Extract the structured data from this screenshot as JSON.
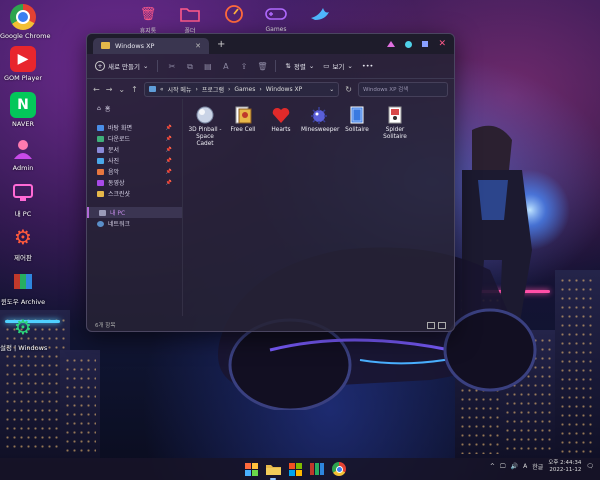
{
  "desktop": {
    "icons": [
      {
        "label": "Google Chrome",
        "icon": "chrome-icon"
      },
      {
        "label": "GOM Player",
        "icon": "gom-player-icon"
      },
      {
        "label": "NAVER",
        "icon": "naver-icon"
      },
      {
        "label": "Admin",
        "icon": "user-icon"
      },
      {
        "label": "내 PC",
        "icon": "pc-icon"
      },
      {
        "label": "제어판",
        "icon": "control-panel-icon"
      },
      {
        "label": "윈도우 Archive",
        "icon": "archive-icon"
      },
      {
        "label": "설정 | Windows",
        "icon": "settings-icon"
      }
    ],
    "top_icons": [
      {
        "label": "휴지통",
        "icon": "recycle-bin-icon"
      },
      {
        "label": "폴더",
        "icon": "folder-icon"
      },
      {
        "label": "",
        "icon": "speedometer-icon"
      },
      {
        "label": "Games",
        "icon": "gamepad-icon"
      },
      {
        "label": "",
        "icon": "bird-icon"
      }
    ]
  },
  "window": {
    "tab_title": "Windows XP",
    "new_label": "새로 만들기",
    "sort_label": "정렬",
    "view_label": "보기",
    "more_label": "•••",
    "breadcrumb": [
      "«",
      "시작 메뉴",
      "프로그램",
      "Games",
      "Windows XP"
    ],
    "search_placeholder": "Windows XP 검색",
    "sidebar": {
      "home": "홈",
      "quick": [
        {
          "label": "바탕 화면",
          "color": "#4a8ee8"
        },
        {
          "label": "다운로드",
          "color": "#3fb07a"
        },
        {
          "label": "문서",
          "color": "#8a8ad8"
        },
        {
          "label": "사진",
          "color": "#4aa8e8"
        },
        {
          "label": "음악",
          "color": "#e8773f"
        },
        {
          "label": "동영상",
          "color": "#a84ae8"
        },
        {
          "label": "스크린샷",
          "color": "#e6b84a"
        }
      ],
      "this_pc": "내 PC",
      "network": "네트워크"
    },
    "files": [
      {
        "name": "3D Pinball - Space Cadet",
        "icon": "pinball-icon"
      },
      {
        "name": "Free Cell",
        "icon": "freecell-icon"
      },
      {
        "name": "Hearts",
        "icon": "hearts-icon"
      },
      {
        "name": "Minesweeper",
        "icon": "minesweeper-icon"
      },
      {
        "name": "Solitaire",
        "icon": "solitaire-icon"
      },
      {
        "name": "Spider Solitaire",
        "icon": "spider-solitaire-icon"
      }
    ],
    "status_text": "6개 항목"
  },
  "taskbar": {
    "apps": [
      "start-icon",
      "file-explorer-icon",
      "store-icon",
      "winrar-icon",
      "chrome-icon"
    ],
    "lang": "한글",
    "ime": "A",
    "time_period": "오후",
    "time": "2:44:34",
    "date": "2022-11-12"
  }
}
